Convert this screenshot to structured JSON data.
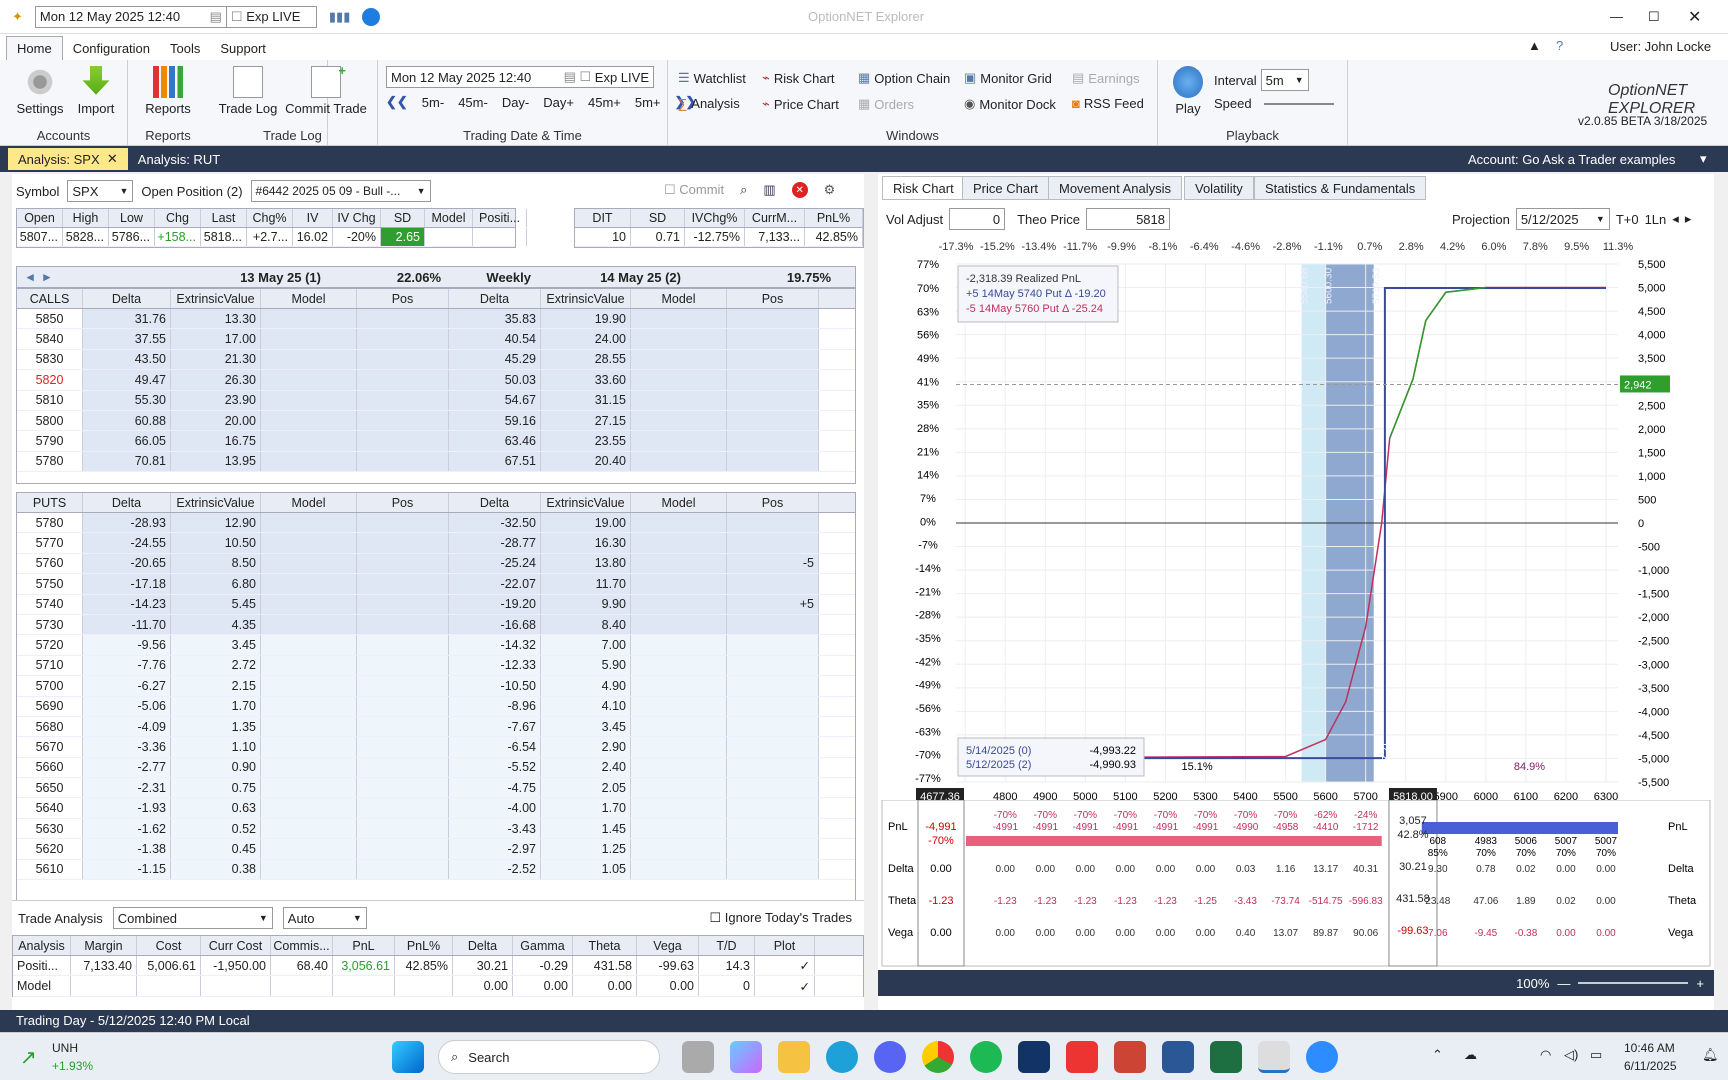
{
  "title_bar": {
    "datetime": "Mon 12 May 2025 12:40",
    "exp": "Exp LIVE",
    "app_title": "OptionNET Explorer"
  },
  "menu": [
    "Home",
    "Configuration",
    "Tools",
    "Support"
  ],
  "user": "User: John Locke",
  "ribbon": {
    "settings": "Settings",
    "import": "Import",
    "accounts": "Accounts",
    "reports": "Reports",
    "reports_group": "Reports",
    "trade_log": "Trade Log",
    "commit_trade": "Commit Trade",
    "trade_log_group": "Trade Log",
    "date": "Mon 12 May 2025 12:40",
    "exp": "Exp LIVE",
    "steps": [
      "5m-",
      "45m-",
      "Day-",
      "Day+",
      "45m+",
      "5m+"
    ],
    "trading_group": "Trading Date & Time",
    "windows": [
      "Watchlist",
      "Risk Chart",
      "Option Chain",
      "Monitor Grid",
      "Earnings",
      "Analysis",
      "Price Chart",
      "Orders",
      "Monitor Dock",
      "RSS Feed"
    ],
    "windows_group": "Windows",
    "play": "Play",
    "interval_label": "Interval",
    "interval": "5m",
    "speed": "Speed",
    "playback_group": "Playback",
    "version": "v2.0.85 BETA 3/18/2025",
    "logo": "OptionNET EXPLORER"
  },
  "doc_tabs": [
    "Analysis: SPX",
    "Analysis: RUT"
  ],
  "account": "Account: Go Ask a Trader examples",
  "symbol_bar": {
    "symbol_label": "Symbol",
    "symbol": "SPX",
    "open_pos_label": "Open Position (2)",
    "position": "#6442 2025 05 09 - Bull -...",
    "commit": "Commit"
  },
  "quote": {
    "headers": [
      "Open",
      "High",
      "Low",
      "Chg",
      "Last",
      "Chg%",
      "IV",
      "IV Chg",
      "SD",
      "Model",
      "Positi..."
    ],
    "values": [
      "5807...",
      "5828...",
      "5786...",
      "+158...",
      "5818...",
      "+2.7...",
      "16.02",
      "-20%",
      "2.65",
      "",
      ""
    ]
  },
  "quote2": {
    "headers": [
      "DIT",
      "SD",
      "IVChg%",
      "CurrM...",
      "PnL%"
    ],
    "values": [
      "10",
      "0.71",
      "-12.75%",
      "7,133...",
      "42.85%"
    ]
  },
  "exp_headers": {
    "left": "13 May 25 (1)",
    "left_pct": "22.06%",
    "weekly": "Weekly",
    "right": "14 May 25 (2)",
    "right_pct": "19.75%"
  },
  "calls_cols": [
    "CALLS",
    "Delta",
    "ExtrinsicValue",
    "Model",
    "Pos",
    "Delta",
    "ExtrinsicValue",
    "Model",
    "Pos"
  ],
  "calls": [
    [
      "5850",
      "31.76",
      "13.30",
      "35.83",
      "19.90",
      ""
    ],
    [
      "5840",
      "37.55",
      "17.00",
      "40.54",
      "24.00",
      ""
    ],
    [
      "5830",
      "43.50",
      "21.30",
      "45.29",
      "28.55",
      ""
    ],
    [
      "5820",
      "49.47",
      "26.30",
      "50.03",
      "33.60",
      ""
    ],
    [
      "5810",
      "55.30",
      "23.90",
      "54.67",
      "31.15",
      ""
    ],
    [
      "5800",
      "60.88",
      "20.00",
      "59.16",
      "27.15",
      ""
    ],
    [
      "5790",
      "66.05",
      "16.75",
      "63.46",
      "23.55",
      ""
    ],
    [
      "5780",
      "70.81",
      "13.95",
      "67.51",
      "20.40",
      ""
    ]
  ],
  "puts_cols": [
    "PUTS",
    "Delta",
    "ExtrinsicValue",
    "Model",
    "Pos",
    "Delta",
    "ExtrinsicValue",
    "Model",
    "Pos"
  ],
  "puts": [
    [
      "5780",
      "-28.93",
      "12.90",
      "-32.50",
      "19.00",
      ""
    ],
    [
      "5770",
      "-24.55",
      "10.50",
      "-28.77",
      "16.30",
      ""
    ],
    [
      "5760",
      "-20.65",
      "8.50",
      "-25.24",
      "13.80",
      "-5"
    ],
    [
      "5750",
      "-17.18",
      "6.80",
      "-22.07",
      "11.70",
      ""
    ],
    [
      "5740",
      "-14.23",
      "5.45",
      "-19.20",
      "9.90",
      "+5"
    ],
    [
      "5730",
      "-11.70",
      "4.35",
      "-16.68",
      "8.40",
      ""
    ],
    [
      "5720",
      "-9.56",
      "3.45",
      "-14.32",
      "7.00",
      ""
    ],
    [
      "5710",
      "-7.76",
      "2.72",
      "-12.33",
      "5.90",
      ""
    ],
    [
      "5700",
      "-6.27",
      "2.15",
      "-10.50",
      "4.90",
      ""
    ],
    [
      "5690",
      "-5.06",
      "1.70",
      "-8.96",
      "4.10",
      ""
    ],
    [
      "5680",
      "-4.09",
      "1.35",
      "-7.67",
      "3.45",
      ""
    ],
    [
      "5670",
      "-3.36",
      "1.10",
      "-6.54",
      "2.90",
      ""
    ],
    [
      "5660",
      "-2.77",
      "0.90",
      "-5.52",
      "2.40",
      ""
    ],
    [
      "5650",
      "-2.31",
      "0.75",
      "-4.75",
      "2.05",
      ""
    ],
    [
      "5640",
      "-1.93",
      "0.63",
      "-4.00",
      "1.70",
      ""
    ],
    [
      "5630",
      "-1.62",
      "0.52",
      "-3.43",
      "1.45",
      ""
    ],
    [
      "5620",
      "-1.38",
      "0.45",
      "-2.97",
      "1.25",
      ""
    ],
    [
      "5610",
      "-1.15",
      "0.38",
      "-2.52",
      "1.05",
      ""
    ]
  ],
  "trade_analysis": {
    "label": "Trade Analysis",
    "mode": "Combined",
    "auto": "Auto",
    "ignore": "Ignore Today's Trades",
    "cols": [
      "Analysis",
      "Margin",
      "Cost",
      "Curr Cost",
      "Commis...",
      "PnL",
      "PnL%",
      "Delta",
      "Gamma",
      "Theta",
      "Vega",
      "T/D",
      "Plot"
    ],
    "rows": [
      [
        "Positi...",
        "7,133.40",
        "5,006.61",
        "-1,950.00",
        "68.40",
        "3,056.61",
        "42.85%",
        "30.21",
        "-0.29",
        "431.58",
        "-99.63",
        "14.3",
        "✓"
      ],
      [
        "Model",
        "",
        "",
        "",
        "",
        "",
        "",
        "0.00",
        "0.00",
        "0.00",
        "0.00",
        "0",
        "✓"
      ]
    ]
  },
  "status": "Trading Day - 5/12/2025 12:40 PM Local",
  "chart_tabs": [
    "Risk Chart",
    "Price Chart",
    "Movement Analysis",
    "Volatility",
    "Statistics & Fundamentals"
  ],
  "chart_ctrl": {
    "vol_adjust": "Vol Adjust",
    "vol": "0",
    "theo": "Theo Price",
    "theo_val": "5818",
    "projection": "Projection",
    "proj_date": "5/12/2025",
    "t0": "T+0",
    "ln": "1Ln"
  },
  "chart_data": {
    "type": "line",
    "top_pct_labels": [
      "-17.3%",
      "-15.2%",
      "-13.4%",
      "-11.7%",
      "-9.9%",
      "-8.1%",
      "-6.4%",
      "-4.6%",
      "-2.8%",
      "-1.1%",
      "0.7%",
      "2.8%",
      "4.2%",
      "6.0%",
      "7.8%",
      "9.5%",
      "11.3%"
    ],
    "left_axis": [
      "70%",
      "63%",
      "56%",
      "49%",
      "41%",
      "35%",
      "28%",
      "21%",
      "14%",
      "7%",
      "0%",
      "-7%",
      "-14%",
      "-21%",
      "-28%",
      "-35%",
      "-42%",
      "-49%",
      "-56%",
      "-63%",
      "-70%",
      "-77%"
    ],
    "left_top_label": "77%",
    "right_axis": [
      "5,500",
      "5,000",
      "4,500",
      "4,000",
      "3,500",
      "3,000",
      "2,500",
      "2,000",
      "1,500",
      "1,000",
      "500",
      "0",
      "-500",
      "-1,000",
      "-1,500",
      "-2,000",
      "-2,500",
      "-3,000",
      "-3,500",
      "-4,000",
      "-4,500",
      "-5,000",
      "-5,500"
    ],
    "x_ticks": [
      "4800",
      "4900",
      "5000",
      "5100",
      "5200",
      "5300",
      "5400",
      "5500",
      "5600",
      "5700",
      "5900",
      "6000",
      "6100",
      "6200",
      "6300"
    ],
    "x_left_value": "4677.36",
    "x_cursor_value": "5818.00",
    "x_range": [
      4677,
      6330
    ],
    "y_range": [
      -5500,
      5500
    ],
    "cursor_value": "2,942",
    "series": [
      {
        "points": [
          [
            4700,
            -4991
          ],
          [
            5500,
            -4958
          ],
          [
            5600,
            -4600
          ],
          [
            5650,
            -3800
          ],
          [
            5700,
            -2200
          ],
          [
            5740,
            0
          ],
          [
            5760,
            1800
          ],
          [
            5818,
            3057
          ],
          [
            5850,
            4300
          ],
          [
            5900,
            4900
          ],
          [
            6000,
            5000
          ],
          [
            6300,
            5000
          ]
        ]
      },
      {
        "points": [
          [
            4700,
            -4993
          ],
          [
            5700,
            -4993
          ],
          [
            5748,
            -4993
          ],
          [
            5748,
            4990
          ],
          [
            6300,
            4990
          ]
        ]
      }
    ],
    "band_labels": [
      "5540.68",
      "5600.30",
      "5719.53"
    ],
    "expiry_label": "5748.21",
    "pct_labels": [
      "15.1%",
      "84.9%"
    ],
    "legend": [
      "-2,318.39 Realized PnL",
      "+5 14May 5740 Put Δ  -19.20",
      "-5 14May 5760 Put Δ  -25.24"
    ],
    "tooltip": [
      [
        "5/14/2025 (0)",
        "-4,993.22"
      ],
      [
        "5/12/2025 (2)",
        "-4,990.93"
      ]
    ]
  },
  "bottom_rows": {
    "pnl_label": "PnL",
    "delta_label": "Delta",
    "theta_label": "Theta",
    "vega_label": "Vega",
    "pnl_left": "-4,991",
    "pnl_left_pct": "-70%",
    "delta_left": "0.00",
    "theta_left": "-1.23",
    "vega_left": "0.00",
    "pnl_cells": [
      "-70%\n-4991",
      "-70%\n-4991",
      "-70%\n-4991",
      "-70%\n-4991",
      "-70%\n-4991",
      "-70%\n-4991",
      "-70%\n-4990",
      "-70%\n-4958",
      "-62%\n-4410",
      "-24%\n-1712"
    ],
    "pnl_right": [
      "608\n85%",
      "4983\n70%",
      "5006\n70%",
      "5007\n70%",
      "5007\n70%"
    ],
    "delta_cells": [
      "0.00",
      "0.00",
      "0.00",
      "0.00",
      "0.00",
      "0.00",
      "0.03",
      "1.16",
      "13.17",
      "40.31"
    ],
    "delta_right": [
      "9.30",
      "0.78",
      "0.02",
      "0.00",
      "0.00"
    ],
    "theta_cells": [
      "-1.23",
      "-1.23",
      "-1.23",
      "-1.23",
      "-1.23",
      "-1.25",
      "-3.43",
      "-73.74",
      "-514.75",
      "-596.83"
    ],
    "theta_right": [
      "23.48",
      "47.06",
      "1.89",
      "0.02",
      "0.00"
    ],
    "vega_cells": [
      "0.00",
      "0.00",
      "0.00",
      "0.00",
      "0.00",
      "0.00",
      "0.40",
      "13.07",
      "89.87",
      "90.06"
    ],
    "vega_right": [
      "7.06",
      "-9.45",
      "-0.38",
      "0.00",
      "0.00"
    ],
    "cursor": [
      "3,057",
      "42.8%",
      "30.21",
      "431.58",
      "-99.63"
    ]
  },
  "zoom": "100%",
  "taskbar": {
    "ticker": "UNH",
    "ticker_chg": "+1.93%",
    "search": "Search",
    "time": "10:46 AM",
    "date": "6/11/2025"
  },
  "colors": {
    "navy": "#2b3a52",
    "green": "#2e9e2e",
    "red": "#c0305a",
    "blue": "#4a5fd6"
  }
}
